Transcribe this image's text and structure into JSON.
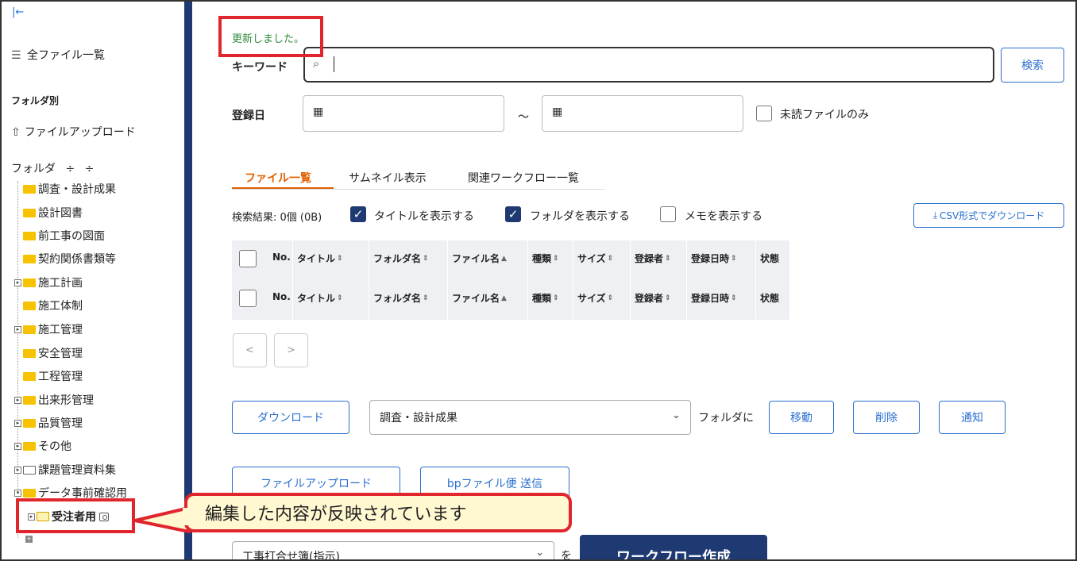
{
  "sidebar": {
    "all_files": "全ファイル一覧",
    "by_folder": "フォルダ別",
    "file_upload": "ファイルアップロード",
    "folder_header": "フォルダ",
    "expand_glyph": "÷",
    "tree": [
      {
        "label": "調査・設計成果",
        "expandable": false
      },
      {
        "label": "設計図書",
        "expandable": false
      },
      {
        "label": "前工事の図面",
        "expandable": false
      },
      {
        "label": "契約関係書類等",
        "expandable": false
      },
      {
        "label": "施工計画",
        "expandable": true
      },
      {
        "label": "施工体制",
        "expandable": false
      },
      {
        "label": "施工管理",
        "expandable": true
      },
      {
        "label": "安全管理",
        "expandable": false
      },
      {
        "label": "工程管理",
        "expandable": false
      },
      {
        "label": "出来形管理",
        "expandable": true
      },
      {
        "label": "品質管理",
        "expandable": true
      },
      {
        "label": "その他",
        "expandable": true
      },
      {
        "label": "課題管理資料集",
        "expandable": true
      },
      {
        "label": "データ事前確認用",
        "expandable": true
      },
      {
        "label": "受注者用",
        "expandable": true,
        "selected": true
      }
    ]
  },
  "main": {
    "status_message": "更新しました。",
    "keyword_label": "キーワード",
    "search_button": "検索",
    "date_label": "登録日",
    "date_separator": "～",
    "unread_only": "未読ファイルのみ",
    "tabs": [
      "ファイル一覧",
      "サムネイル表示",
      "関連ワークフロー一覧"
    ],
    "active_tab": "ファイル一覧",
    "result_count": "検索結果: 0個 (0B)",
    "show_title": "タイトルを表示する",
    "show_folder": "フォルダを表示する",
    "show_memo": "メモを表示する",
    "csv_download": "CSV形式でダウンロード",
    "table_headers": [
      "No.",
      "タイトル",
      "フォルダ名",
      "ファイル名",
      "種類",
      "サイズ",
      "登録者",
      "登録日時",
      "状態"
    ],
    "prev": "<",
    "next": ">",
    "download_button": "ダウンロード",
    "folder_select": "調査・設計成果",
    "to_folder": "フォルダに",
    "move_button": "移動",
    "delete_button": "削除",
    "notify_button": "通知",
    "upload_button": "ファイルアップロード",
    "bp_send_button": "bpファイル便 送信",
    "workflow_select": "工事打合せ簿(指示)",
    "wo": "を",
    "workflow_button": "ワークフロー作成"
  },
  "annotation": {
    "callout_text": "編集した内容が反映されています",
    "accent": "#e0262c"
  },
  "colors": {
    "brand": "#1f3a73",
    "link": "#2a6fd1",
    "success": "#2e8b3a",
    "tab_active": "#e06000"
  }
}
